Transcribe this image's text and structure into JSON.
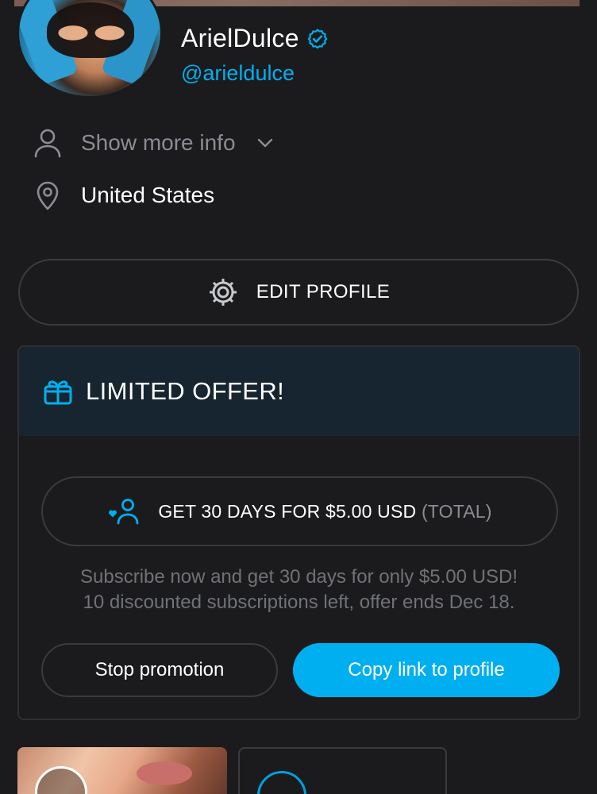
{
  "profile": {
    "display_name": "ArielDulce",
    "handle": "@arieldulce",
    "show_more_label": "Show more info",
    "location": "United States"
  },
  "actions": {
    "edit_profile_label": "EDIT PROFILE"
  },
  "offer": {
    "title": "LIMITED OFFER!",
    "get_label": "GET 30 DAYS FOR $5.00 USD",
    "get_total": "(TOTAL)",
    "desc_line1": "Subscribe now and get 30 days for only $5.00 USD!",
    "desc_line2": "10 discounted subscriptions left, offer ends Dec 18.",
    "stop_label": "Stop promotion",
    "copy_label": "Copy link to profile"
  },
  "colors": {
    "background": "#1b1b1d",
    "accent": "#00aff0",
    "offer_header_bg": "#16252f",
    "muted_text": "#8a8d93"
  },
  "icons": [
    "verified-icon",
    "user-icon",
    "chevron-down-icon",
    "location-pin-icon",
    "gear-icon",
    "gift-icon",
    "subscribe-heart-icon",
    "clock-icon",
    "heart-ring-icon"
  ]
}
